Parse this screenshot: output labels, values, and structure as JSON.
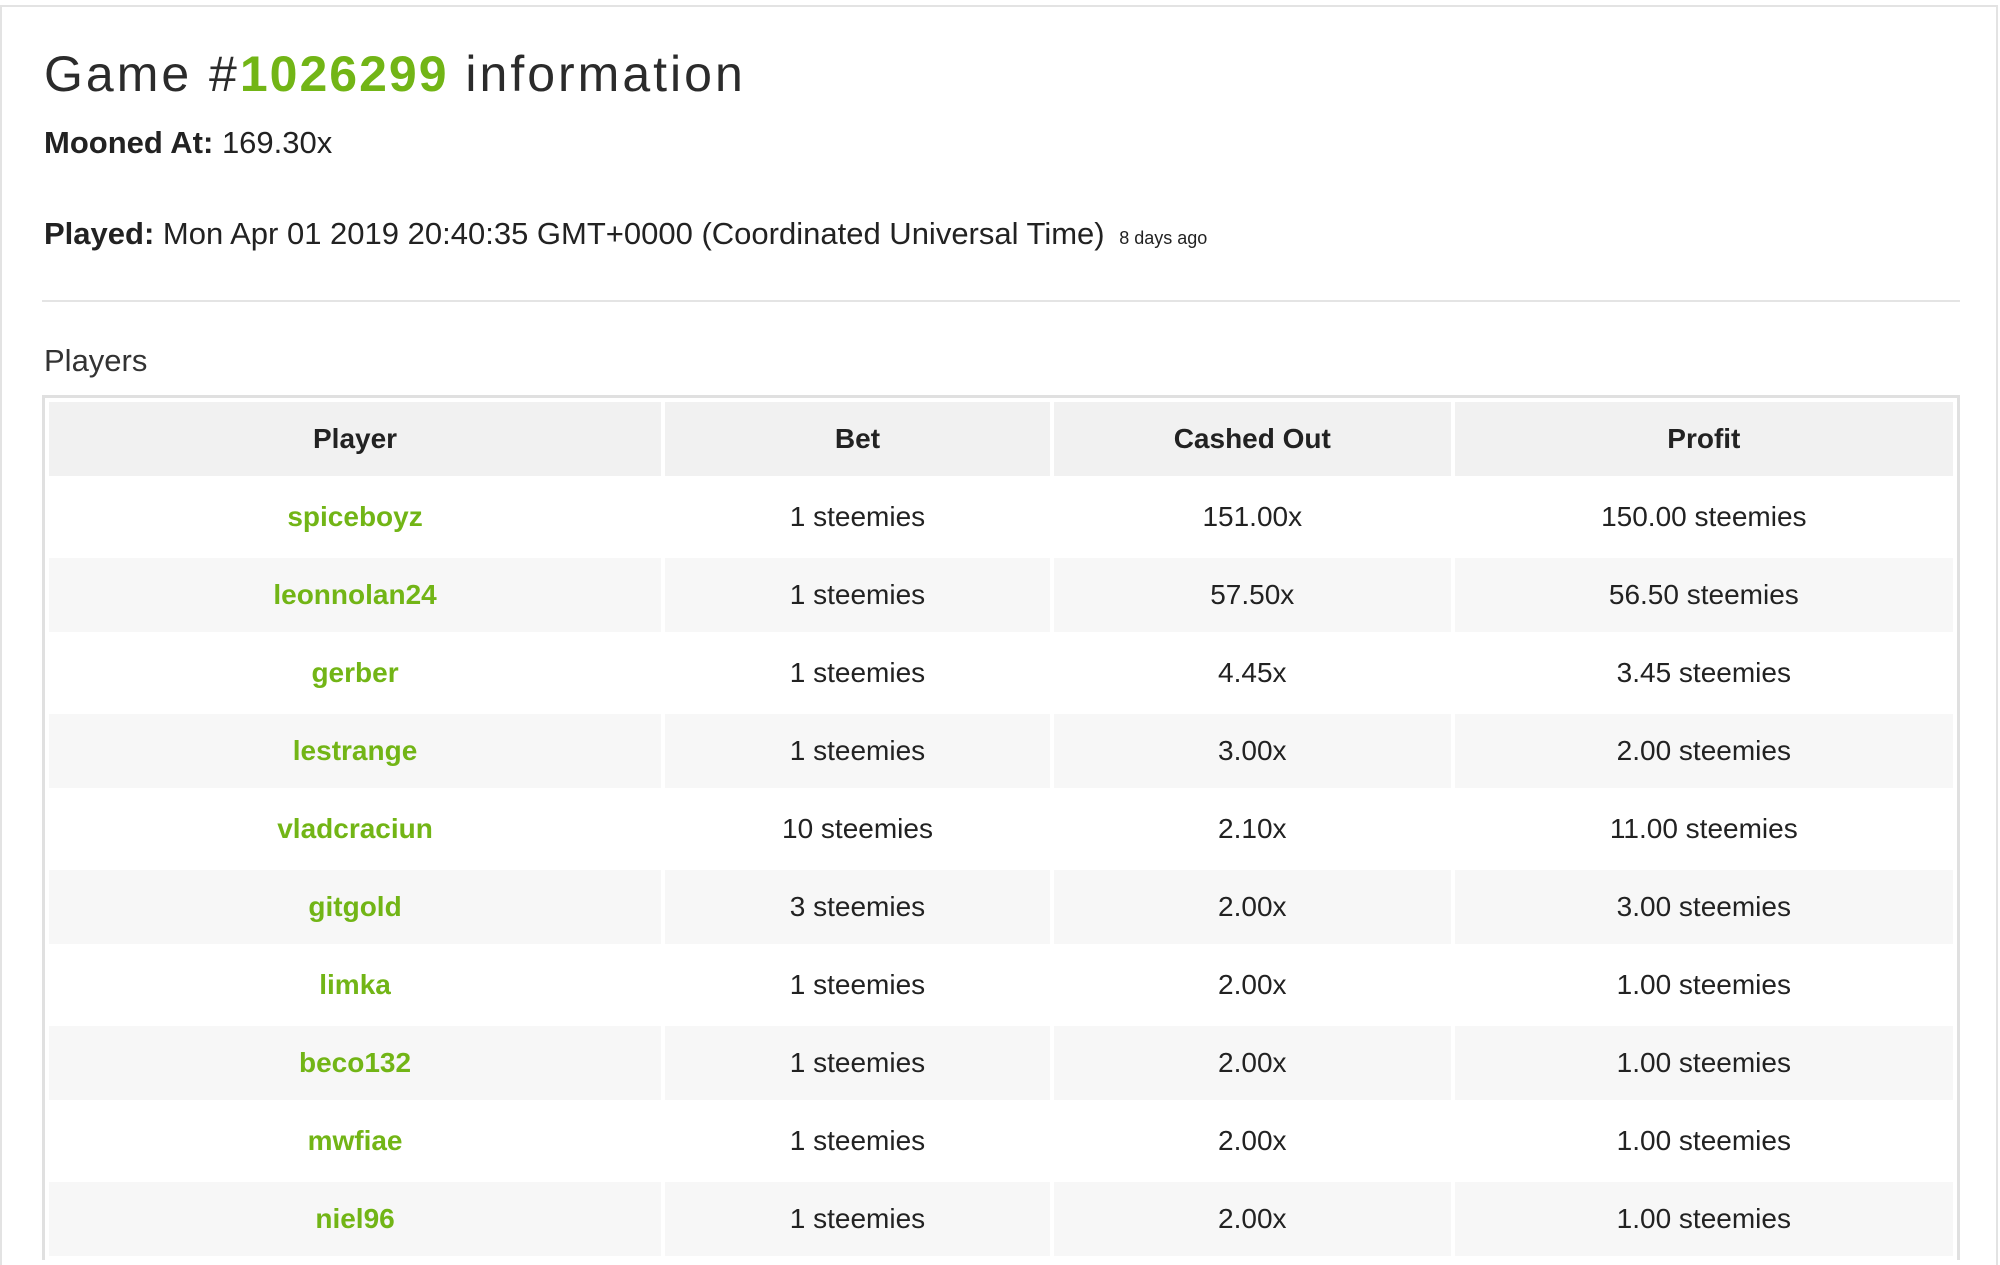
{
  "header": {
    "title_prefix": "Game #",
    "game_id": "1026299",
    "title_suffix": " information"
  },
  "mooned": {
    "label": "Mooned At:",
    "value": "169.30x"
  },
  "played": {
    "label": "Played:",
    "value": "Mon Apr 01 2019 20:40:35 GMT+0000 (Coordinated Universal Time)",
    "ago": "8 days ago"
  },
  "players_section": {
    "heading": "Players",
    "columns": [
      "Player",
      "Bet",
      "Cashed Out",
      "Profit"
    ],
    "rows": [
      {
        "player": "spiceboyz",
        "bet": "1 steemies",
        "cashed_out": "151.00x",
        "profit": "150.00 steemies"
      },
      {
        "player": "leonnolan24",
        "bet": "1 steemies",
        "cashed_out": "57.50x",
        "profit": "56.50 steemies"
      },
      {
        "player": "gerber",
        "bet": "1 steemies",
        "cashed_out": "4.45x",
        "profit": "3.45 steemies"
      },
      {
        "player": "lestrange",
        "bet": "1 steemies",
        "cashed_out": "3.00x",
        "profit": "2.00 steemies"
      },
      {
        "player": "vladcraciun",
        "bet": "10 steemies",
        "cashed_out": "2.10x",
        "profit": "11.00 steemies"
      },
      {
        "player": "gitgold",
        "bet": "3 steemies",
        "cashed_out": "2.00x",
        "profit": "3.00 steemies"
      },
      {
        "player": "limka",
        "bet": "1 steemies",
        "cashed_out": "2.00x",
        "profit": "1.00 steemies"
      },
      {
        "player": "beco132",
        "bet": "1 steemies",
        "cashed_out": "2.00x",
        "profit": "1.00 steemies"
      },
      {
        "player": "mwfiae",
        "bet": "1 steemies",
        "cashed_out": "2.00x",
        "profit": "1.00 steemies"
      },
      {
        "player": "niel96",
        "bet": "1 steemies",
        "cashed_out": "2.00x",
        "profit": "1.00 steemies"
      }
    ]
  },
  "colors": {
    "accent": "#72b516",
    "header_bg": "#f1f1f1",
    "stripe_bg": "#f7f7f7",
    "border": "#e0e0e0"
  }
}
